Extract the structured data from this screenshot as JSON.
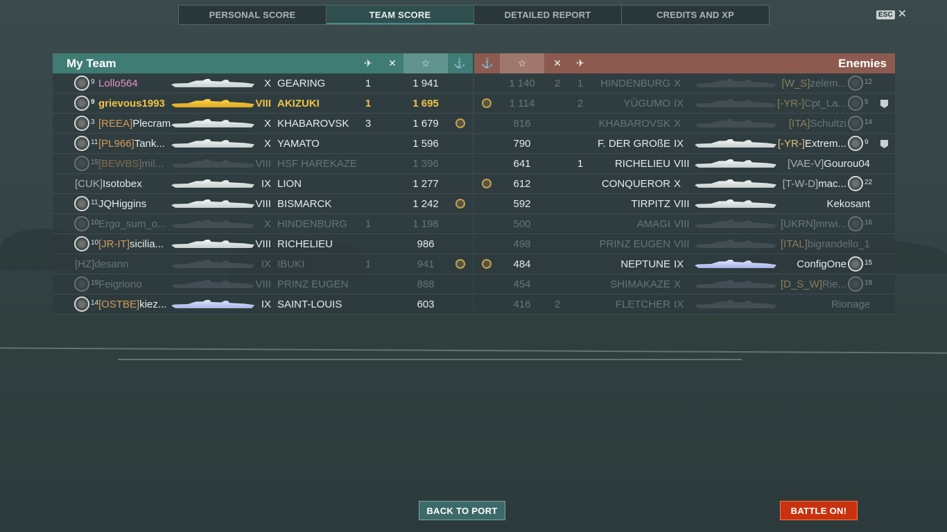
{
  "tabs": [
    {
      "label": "PERSONAL SCORE",
      "active": false
    },
    {
      "label": "TEAM SCORE",
      "active": true
    },
    {
      "label": "DETAILED REPORT",
      "active": false
    },
    {
      "label": "CREDITS AND XP",
      "active": false
    }
  ],
  "esc": {
    "key": "ESC",
    "close": "✕"
  },
  "my_team": {
    "title": "My Team",
    "headers": {
      "planes": "✈",
      "frags": "✕",
      "score": "☆",
      "ribbon": "⚓"
    },
    "rows": [
      {
        "level": "9",
        "clan": "",
        "name": "Lollo564",
        "tier": "X",
        "ship": "GEARING",
        "planes": "1",
        "frags": "",
        "score": "1 941",
        "ribbon": false,
        "dim": false,
        "me": false,
        "ship_color": "w",
        "name_color": "#e58fc8"
      },
      {
        "level": "9",
        "clan": "",
        "name": "grievous1993",
        "tier": "VIII",
        "ship": "AKIZUKI",
        "planes": "1",
        "frags": "",
        "score": "1 695",
        "ribbon": false,
        "dim": false,
        "me": true,
        "ship_color": "y"
      },
      {
        "level": "3",
        "clan": "[REEA]",
        "name": "Plecram",
        "tier": "X",
        "ship": "KHABAROVSK",
        "planes": "3",
        "frags": "",
        "score": "1 679",
        "ribbon": true,
        "dim": false,
        "me": false,
        "ship_color": "w"
      },
      {
        "level": "11",
        "clan": "[PL966]",
        "name": "Tank...",
        "tier": "X",
        "ship": "YAMATO",
        "planes": "",
        "frags": "",
        "score": "1 596",
        "ribbon": false,
        "dim": false,
        "me": false,
        "ship_color": "w"
      },
      {
        "level": "15",
        "clan": "[BEWBS]",
        "name": "mil...",
        "tier": "VIII",
        "ship": "HSF HAREKAZE",
        "planes": "",
        "frags": "",
        "score": "1 396",
        "ribbon": false,
        "dim": true,
        "me": false,
        "ship_color": "d"
      },
      {
        "level": "",
        "clan": "[CUK]",
        "name": "Isotobex",
        "tier": "IX",
        "ship": "LION",
        "planes": "",
        "frags": "",
        "score": "1 277",
        "ribbon": false,
        "dim": false,
        "me": false,
        "ship_color": "w",
        "clan_style": "grey"
      },
      {
        "level": "11",
        "clan": "",
        "name": "JQHiggins",
        "tier": "VIII",
        "ship": "BISMARCK",
        "planes": "",
        "frags": "",
        "score": "1 242",
        "ribbon": true,
        "dim": false,
        "me": false,
        "ship_color": "w"
      },
      {
        "level": "10",
        "clan": "",
        "name": "Ergo_sum_o...",
        "tier": "X",
        "ship": "HINDENBURG",
        "planes": "1",
        "frags": "",
        "score": "1 198",
        "ribbon": false,
        "dim": true,
        "me": false,
        "ship_color": "d"
      },
      {
        "level": "10",
        "clan": "[JR-IT]",
        "name": "sicilia...",
        "tier": "VIII",
        "ship": "RICHELIEU",
        "planes": "",
        "frags": "",
        "score": "986",
        "ribbon": false,
        "dim": false,
        "me": false,
        "ship_color": "w"
      },
      {
        "level": "",
        "clan": "[HZ]",
        "name": "desann",
        "tier": "IX",
        "ship": "IBUKI",
        "planes": "1",
        "frags": "",
        "score": "941",
        "ribbon": true,
        "dim": true,
        "me": false,
        "ship_color": "d",
        "clan_style": "grey"
      },
      {
        "level": "19",
        "clan": "",
        "name": "Feigriono",
        "tier": "VIII",
        "ship": "PRINZ EUGEN",
        "planes": "",
        "frags": "",
        "score": "888",
        "ribbon": false,
        "dim": true,
        "me": false,
        "ship_color": "d"
      },
      {
        "level": "14",
        "clan": "[OSTBE]",
        "name": "kiez...",
        "tier": "IX",
        "ship": "SAINT-LOUIS",
        "planes": "",
        "frags": "",
        "score": "603",
        "ribbon": false,
        "dim": false,
        "me": false,
        "ship_color": "b"
      }
    ]
  },
  "enemies": {
    "title": "Enemies",
    "rows": [
      {
        "score": "1 140",
        "frags": "2",
        "planes": "1",
        "ship": "HINDENBURG",
        "tier": "X",
        "clan": "[W_S]",
        "name": "zelem...",
        "level": "12",
        "ribbon": false,
        "dim": true,
        "ship_color": "d",
        "badge": false,
        "clan_style": "yel"
      },
      {
        "score": "1 114",
        "frags": "",
        "planes": "2",
        "ship": "YŪGUMO",
        "tier": "IX",
        "clan": "[-YR-]",
        "name": "Cpt_La...",
        "level": "5",
        "ribbon": true,
        "dim": true,
        "ship_color": "d",
        "badge": true,
        "clan_style": "yel"
      },
      {
        "score": "816",
        "frags": "",
        "planes": "",
        "ship": "KHABAROVSK",
        "tier": "X",
        "clan": "[ITA]",
        "name": "Schultzi",
        "level": "14",
        "ribbon": false,
        "dim": true,
        "ship_color": "d",
        "badge": false,
        "clan_style": "yel"
      },
      {
        "score": "790",
        "frags": "",
        "planes": "",
        "ship": "F. DER GROßE",
        "tier": "IX",
        "clan": "[-YR-]",
        "name": "Extrem...",
        "level": "9",
        "ribbon": false,
        "dim": false,
        "ship_color": "w",
        "badge": true,
        "clan_style": "yel"
      },
      {
        "score": "641",
        "frags": "",
        "planes": "1",
        "ship": "RICHELIEU",
        "tier": "VIII",
        "clan": "[VAE-V]",
        "name": "Gourou04",
        "level": "",
        "ribbon": false,
        "dim": false,
        "ship_color": "w",
        "badge": false,
        "clan_style": "grey"
      },
      {
        "score": "612",
        "frags": "",
        "planes": "",
        "ship": "CONQUEROR",
        "tier": "X",
        "clan": "[T-W-D]",
        "name": "mac...",
        "level": "22",
        "ribbon": true,
        "dim": false,
        "ship_color": "w",
        "badge": false,
        "clan_style": "grey"
      },
      {
        "score": "592",
        "frags": "",
        "planes": "",
        "ship": "TIRPITZ",
        "tier": "VIII",
        "clan": "",
        "name": "Kekosant",
        "level": "",
        "ribbon": false,
        "dim": false,
        "ship_color": "w",
        "badge": false
      },
      {
        "score": "500",
        "frags": "",
        "planes": "",
        "ship": "AMAGI",
        "tier": "VIII",
        "clan": "[UKRN]",
        "name": "mrwi...",
        "level": "16",
        "ribbon": false,
        "dim": true,
        "ship_color": "d",
        "badge": false,
        "clan_style": "grey"
      },
      {
        "score": "498",
        "frags": "",
        "planes": "",
        "ship": "PRINZ EUGEN",
        "tier": "VIII",
        "clan": "[ITAL]",
        "name": "bigrandello_1",
        "level": "",
        "ribbon": false,
        "dim": true,
        "ship_color": "d",
        "badge": false,
        "clan_style": "yel"
      },
      {
        "score": "484",
        "frags": "",
        "planes": "",
        "ship": "NEPTUNE",
        "tier": "IX",
        "clan": "",
        "name": "ConfigOne",
        "level": "15",
        "ribbon": true,
        "dim": false,
        "ship_color": "b",
        "badge": false
      },
      {
        "score": "454",
        "frags": "",
        "planes": "",
        "ship": "SHIMAKAZE",
        "tier": "X",
        "clan": "[D_S_W]",
        "name": "Rie...",
        "level": "19",
        "ribbon": false,
        "dim": true,
        "ship_color": "d",
        "badge": false,
        "clan_style": "yel"
      },
      {
        "score": "416",
        "frags": "2",
        "planes": "",
        "ship": "FLETCHER",
        "tier": "IX",
        "clan": "",
        "name": "Rionage",
        "level": "",
        "ribbon": false,
        "dim": true,
        "ship_color": "d",
        "badge": false
      }
    ]
  },
  "buttons": {
    "back": "BACK TO PORT",
    "battle": "BATTLE ON!"
  }
}
